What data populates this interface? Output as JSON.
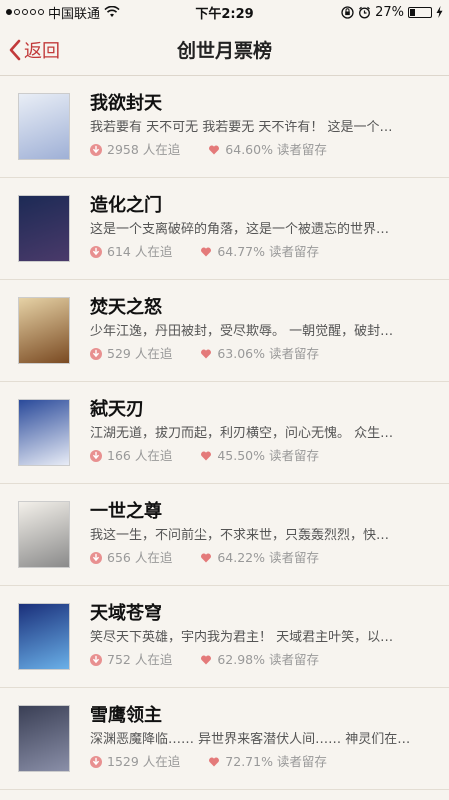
{
  "status_bar": {
    "carrier": "中国联通",
    "time": "下午2:29",
    "battery": "27%",
    "battery_level": 0.27
  },
  "nav": {
    "back_label": "返回",
    "title": "创世月票榜"
  },
  "colors": {
    "accent": "#c23a3a",
    "background": "#f7f4ef"
  },
  "books": [
    {
      "title": "我欲封天",
      "desc": "我若要有 天不可无 我若要无 天不许有！ 这是一个…",
      "followers": "2958 人在追",
      "retention": "64.60% 读者留存",
      "cover_text": "我欲封天",
      "cover_colors": [
        "#e9eef6",
        "#9fb0d6"
      ]
    },
    {
      "title": "造化之门",
      "desc": "这是一个支离破碎的角落，这是一个被遗忘的世界…",
      "followers": "614 人在追",
      "retention": "64.77% 读者留存",
      "cover_text": "造化之门",
      "cover_colors": [
        "#1c2a55",
        "#4a3a6a"
      ]
    },
    {
      "title": "焚天之怒",
      "desc": "少年江逸，丹田被封，受尽欺辱。 一朝觉醒，破封…",
      "followers": "529 人在追",
      "retention": "63.06% 读者留存",
      "cover_text": "焚天之怒",
      "cover_colors": [
        "#e6d2a6",
        "#7a4a22"
      ]
    },
    {
      "title": "弑天刃",
      "desc": "江湖无道，拔刀而起，利刃横空，问心无愧。 众生…",
      "followers": "166 人在追",
      "retention": "45.50% 读者留存",
      "cover_text": "弑天刃",
      "cover_colors": [
        "#2a4a9a",
        "#e8ecf6"
      ]
    },
    {
      "title": "一世之尊",
      "desc": "我这一生，不问前尘，不求来世，只轰轰烈烈，快…",
      "followers": "656 人在追",
      "retention": "64.22% 读者留存",
      "cover_text": "一世之尊",
      "cover_colors": [
        "#f3f0ea",
        "#8a8a8a"
      ]
    },
    {
      "title": "天域苍穹",
      "desc": "笑尽天下英雄，宇内我为君主！ 天域君主叶笑，以…",
      "followers": "752 人在追",
      "retention": "62.98% 读者留存",
      "cover_text": "天域苍穹",
      "cover_colors": [
        "#1a2f7a",
        "#6ab0e8"
      ]
    },
    {
      "title": "雪鹰领主",
      "desc": "深渊恶魔降临…… 异世界来客潜伏人间…… 神灵们在…",
      "followers": "1529 人在追",
      "retention": "72.71% 读者留存",
      "cover_text": "雪鹰领主",
      "cover_colors": [
        "#3a3f55",
        "#8a8fa8"
      ]
    }
  ]
}
